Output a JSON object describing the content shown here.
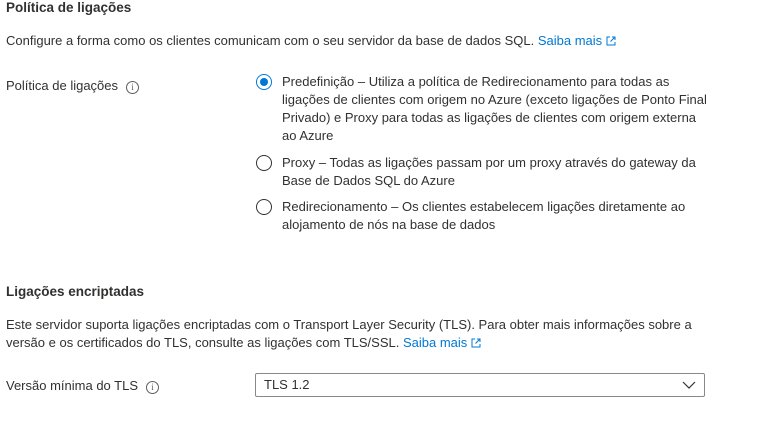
{
  "connection_policy": {
    "title": "Política de ligações",
    "description": "Configure a forma como os clientes comunicam com o seu servidor da base de dados SQL.",
    "learn_more": "Saiba mais",
    "field_label": "Política de ligações",
    "options": [
      {
        "label": "Predefinição – Utiliza a política de Redirecionamento para todas as ligações de clientes com origem no Azure (exceto ligações de Ponto Final Privado) e Proxy para todas as ligações de clientes com origem externa ao Azure",
        "selected": true
      },
      {
        "label": "Proxy – Todas as ligações passam por um proxy através do gateway da Base de Dados SQL do Azure",
        "selected": false
      },
      {
        "label": "Redirecionamento – Os clientes estabelecem ligações diretamente ao alojamento de nós na base de dados",
        "selected": false
      }
    ]
  },
  "encrypted_connections": {
    "title": "Ligações encriptadas",
    "description": "Este servidor suporta ligações encriptadas com o Transport Layer Security (TLS). Para obter mais informações sobre a versão e os certificados do TLS, consulte as ligações com TLS/SSL.",
    "learn_more": "Saiba mais",
    "tls_label": "Versão mínima do TLS",
    "tls_value": "TLS 1.2"
  },
  "icons": {
    "info": "i",
    "info_icon_name": "info-icon",
    "external_link_icon_name": "external-link-icon",
    "chevron_icon_name": "chevron-down-icon"
  },
  "colors": {
    "accent": "#0078d4",
    "text": "#323130",
    "border": "#8a8886"
  }
}
